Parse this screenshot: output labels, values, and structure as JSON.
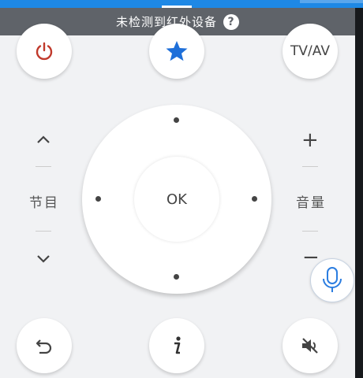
{
  "notice": {
    "text": "未检测到红外设备",
    "help_symbol": "?"
  },
  "buttons": {
    "power_icon": "power-icon",
    "favorite_icon": "star-icon",
    "tvav_label": "TV/AV",
    "back_icon": "back-arrow-icon",
    "info_icon": "info-icon",
    "mute_icon": "mute-icon"
  },
  "channel": {
    "label": "节目",
    "up": "^",
    "down": "v"
  },
  "volume": {
    "label": "音量",
    "plus": "+",
    "minus": "−"
  },
  "dpad": {
    "ok_label": "OK"
  },
  "colors": {
    "power": "#c0392b",
    "star": "#1e6fd9",
    "topbar": "#1e88e5",
    "mic": "#2b7de0"
  }
}
